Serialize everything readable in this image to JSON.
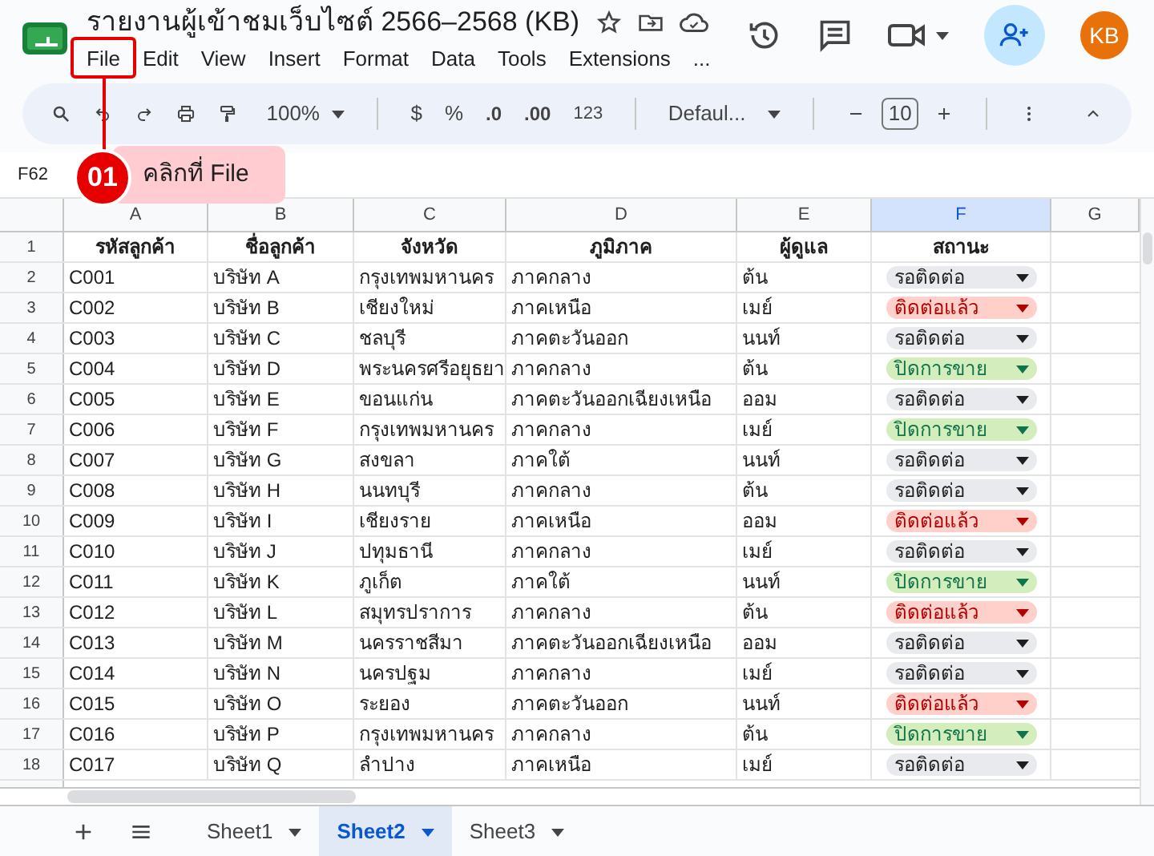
{
  "title": "รายงานผู้เข้าชมเว็บไซต์ 2566–2568 (KB)",
  "menu": [
    "File",
    "Edit",
    "View",
    "Insert",
    "Format",
    "Data",
    "Tools",
    "Extensions",
    "..."
  ],
  "avatar": "KB",
  "toolbar": {
    "zoom": "100%",
    "currency": "$",
    "percent": "%",
    "dec_less": ".0",
    "dec_more": ".00",
    "number_format": "123",
    "font": "Defaul...",
    "font_size": "10"
  },
  "name_box": "F62",
  "callout": {
    "step": "01",
    "text": "คลิกที่ File"
  },
  "columns": [
    {
      "letter": "A",
      "selected": false
    },
    {
      "letter": "B",
      "selected": false
    },
    {
      "letter": "C",
      "selected": false
    },
    {
      "letter": "D",
      "selected": false
    },
    {
      "letter": "E",
      "selected": false
    },
    {
      "letter": "F",
      "selected": true
    },
    {
      "letter": "G",
      "selected": false
    }
  ],
  "header_row": {
    "number": "1",
    "cells": [
      "รหัสลูกค้า",
      "ชื่อลูกค้า",
      "จังหวัด",
      "ภูมิภาค",
      "ผู้ดูแล",
      "สถานะ"
    ]
  },
  "rows": [
    {
      "number": "2",
      "cells": [
        "C001",
        "บริษัท A",
        "กรุงเทพมหานคร",
        "ภาคกลาง",
        "ต้น"
      ],
      "status": {
        "text": "รอติดต่อ",
        "kind": "waiting"
      }
    },
    {
      "number": "3",
      "cells": [
        "C002",
        "บริษัท B",
        "เชียงใหม่",
        "ภาคเหนือ",
        "เมย์"
      ],
      "status": {
        "text": "ติดต่อแล้ว",
        "kind": "contacted"
      }
    },
    {
      "number": "4",
      "cells": [
        "C003",
        "บริษัท C",
        "ชลบุรี",
        "ภาคตะวันออก",
        "นนท์"
      ],
      "status": {
        "text": "รอติดต่อ",
        "kind": "waiting"
      }
    },
    {
      "number": "5",
      "cells": [
        "C004",
        "บริษัท D",
        "พระนครศรีอยุธยา",
        "ภาคกลาง",
        "ต้น"
      ],
      "status": {
        "text": "ปิดการขาย",
        "kind": "closed"
      }
    },
    {
      "number": "6",
      "cells": [
        "C005",
        "บริษัท E",
        "ขอนแก่น",
        "ภาคตะวันออกเฉียงเหนือ",
        "ออม"
      ],
      "status": {
        "text": "รอติดต่อ",
        "kind": "waiting"
      }
    },
    {
      "number": "7",
      "cells": [
        "C006",
        "บริษัท F",
        "กรุงเทพมหานคร",
        "ภาคกลาง",
        "เมย์"
      ],
      "status": {
        "text": "ปิดการขาย",
        "kind": "closed"
      }
    },
    {
      "number": "8",
      "cells": [
        "C007",
        "บริษัท G",
        "สงขลา",
        "ภาคใต้",
        "นนท์"
      ],
      "status": {
        "text": "รอติดต่อ",
        "kind": "waiting"
      }
    },
    {
      "number": "9",
      "cells": [
        "C008",
        "บริษัท H",
        "นนทบุรี",
        "ภาคกลาง",
        "ต้น"
      ],
      "status": {
        "text": "รอติดต่อ",
        "kind": "waiting"
      }
    },
    {
      "number": "10",
      "cells": [
        "C009",
        "บริษัท I",
        "เชียงราย",
        "ภาคเหนือ",
        "ออม"
      ],
      "status": {
        "text": "ติดต่อแล้ว",
        "kind": "contacted"
      }
    },
    {
      "number": "11",
      "cells": [
        "C010",
        "บริษัท J",
        "ปทุมธานี",
        "ภาคกลาง",
        "เมย์"
      ],
      "status": {
        "text": "รอติดต่อ",
        "kind": "waiting"
      }
    },
    {
      "number": "12",
      "cells": [
        "C011",
        "บริษัท K",
        "ภูเก็ต",
        "ภาคใต้",
        "นนท์"
      ],
      "status": {
        "text": "ปิดการขาย",
        "kind": "closed"
      }
    },
    {
      "number": "13",
      "cells": [
        "C012",
        "บริษัท L",
        "สมุทรปราการ",
        "ภาคกลาง",
        "ต้น"
      ],
      "status": {
        "text": "ติดต่อแล้ว",
        "kind": "contacted"
      }
    },
    {
      "number": "14",
      "cells": [
        "C013",
        "บริษัท M",
        "นครราชสีมา",
        "ภาคตะวันออกเฉียงเหนือ",
        "ออม"
      ],
      "status": {
        "text": "รอติดต่อ",
        "kind": "waiting"
      }
    },
    {
      "number": "15",
      "cells": [
        "C014",
        "บริษัท N",
        "นครปฐม",
        "ภาคกลาง",
        "เมย์"
      ],
      "status": {
        "text": "รอติดต่อ",
        "kind": "waiting"
      }
    },
    {
      "number": "16",
      "cells": [
        "C015",
        "บริษัท O",
        "ระยอง",
        "ภาคตะวันออก",
        "นนท์"
      ],
      "status": {
        "text": "ติดต่อแล้ว",
        "kind": "contacted"
      }
    },
    {
      "number": "17",
      "cells": [
        "C016",
        "บริษัท P",
        "กรุงเทพมหานคร",
        "ภาคกลาง",
        "ต้น"
      ],
      "status": {
        "text": "ปิดการขาย",
        "kind": "closed"
      }
    },
    {
      "number": "18",
      "cells": [
        "C017",
        "บริษัท Q",
        "ลำปาง",
        "ภาคเหนือ",
        "เมย์"
      ],
      "status": {
        "text": "รอติดต่อ",
        "kind": "waiting"
      }
    }
  ],
  "sheets": [
    {
      "label": "Sheet1",
      "selected": false
    },
    {
      "label": "Sheet2",
      "selected": true
    },
    {
      "label": "Sheet3",
      "selected": false
    }
  ]
}
